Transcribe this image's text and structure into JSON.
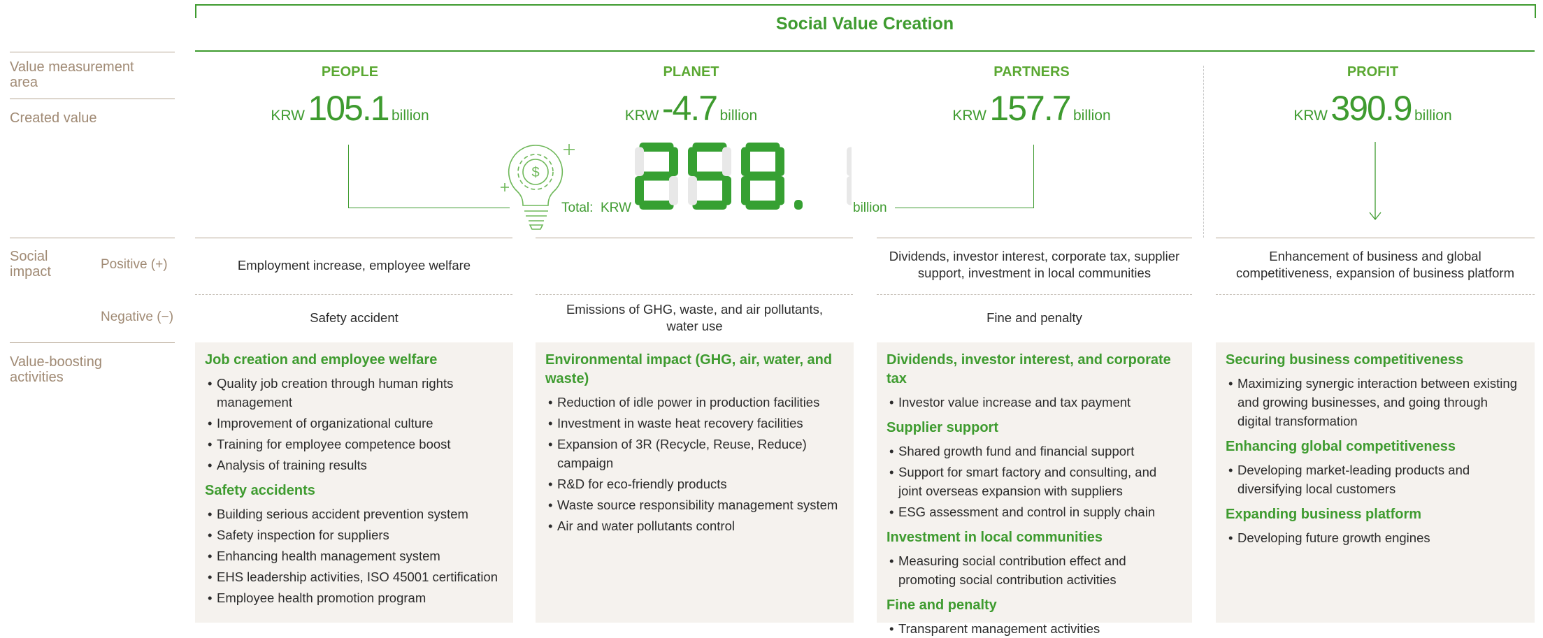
{
  "header": {
    "title": "Social Value Creation"
  },
  "labels": {
    "value_area": "Value measurement area",
    "created_value": "Created value",
    "social_impact": "Social impact",
    "positive": "Positive (+)",
    "negative": "Negative (−)",
    "activities": "Value-boosting activities"
  },
  "columns": [
    {
      "name": "PEOPLE",
      "currency": "KRW",
      "value": "105.1",
      "unit": "billion",
      "positive": "Employment increase, employee welfare",
      "negative": "Safety accident"
    },
    {
      "name": "PLANET",
      "currency": "KRW",
      "value": "-4.7",
      "unit": "billion",
      "positive": "",
      "negative": "Emissions of GHG, waste, and air pollutants, water use"
    },
    {
      "name": "PARTNERS",
      "currency": "KRW",
      "value": "157.7",
      "unit": "billion",
      "positive": "Dividends, investor interest, corporate tax, supplier support, investment in local communities",
      "negative": "Fine and penalty"
    },
    {
      "name": "PROFIT",
      "currency": "KRW",
      "value": "390.9",
      "unit": "billion",
      "positive": "Enhancement of business and global competitiveness, expansion of business platform",
      "negative": ""
    }
  ],
  "total": {
    "label": "Total:",
    "currency": "KRW",
    "value": "258.1",
    "unit": "billion"
  },
  "activities": [
    [
      {
        "title": "Job creation and employee welfare",
        "items": [
          "Quality job creation through human rights management",
          "Improvement of organizational culture",
          "Training for employee competence boost",
          "Analysis of training results"
        ]
      },
      {
        "title": "Safety accidents",
        "items": [
          "Building serious accident prevention system",
          "Safety inspection for suppliers",
          "Enhancing health management system",
          "EHS leadership activities, ISO 45001 certification",
          "Employee health promotion program"
        ]
      }
    ],
    [
      {
        "title": "Environmental impact (GHG, air, water, and waste)",
        "items": [
          "Reduction of idle power in production facilities",
          "Investment in waste heat recovery facilities",
          "Expansion of 3R (Recycle, Reuse, Reduce) campaign",
          "R&D for eco-friendly products",
          "Waste source responsibility management system",
          "Air and water pollutants control"
        ]
      }
    ],
    [
      {
        "title": "Dividends, investor interest, and corporate tax",
        "items": [
          "Investor value increase and tax payment"
        ]
      },
      {
        "title": "Supplier support",
        "items": [
          "Shared growth fund and financial support",
          "Support for smart factory and consulting, and joint overseas expansion with suppliers",
          "ESG assessment and control in supply chain"
        ]
      },
      {
        "title": "Investment in local communities",
        "items": [
          "Measuring social contribution effect and promoting social contribution activities"
        ]
      },
      {
        "title": "Fine and penalty",
        "items": [
          "Transparent management activities"
        ]
      }
    ],
    [
      {
        "title": "Securing business competitiveness",
        "items": [
          "Maximizing synergic interaction between existing and growing businesses, and going through digital transformation"
        ]
      },
      {
        "title": "Enhancing global competitiveness",
        "items": [
          "Developing market-leading products and diversifying local customers"
        ]
      },
      {
        "title": "Expanding business platform",
        "items": [
          "Developing future growth engines"
        ]
      }
    ]
  ]
}
